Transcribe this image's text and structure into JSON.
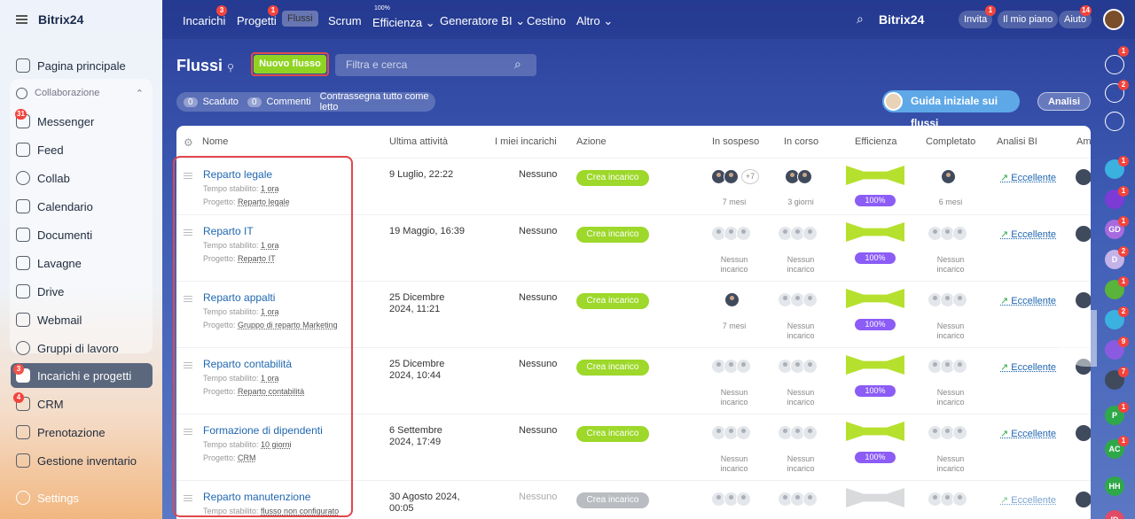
{
  "topbar": {
    "logo": "Bitrix24",
    "nav": [
      {
        "label": "Incarichi",
        "badge": "3"
      },
      {
        "label": "Progetti",
        "badge": "1"
      },
      {
        "label": "Flussi"
      },
      {
        "label": "Scrum"
      },
      {
        "label": "Efficienza",
        "sup": "100%"
      },
      {
        "label": "Generatore BI"
      },
      {
        "label": "Cestino"
      },
      {
        "label": "Altro"
      }
    ],
    "brand": "Bitrix24",
    "invite": "Invita",
    "invite_badge": "1",
    "plan": "Il mio piano",
    "help": "Aiuto",
    "help_badge": "14"
  },
  "sidebar": {
    "logo": "Bitrix24",
    "home": "Pagina principale",
    "group": "Collaborazione",
    "items": [
      {
        "label": "Messenger",
        "badge": "31"
      },
      {
        "label": "Feed"
      },
      {
        "label": "Collab"
      },
      {
        "label": "Calendario"
      },
      {
        "label": "Documenti"
      },
      {
        "label": "Lavagne"
      },
      {
        "label": "Drive"
      },
      {
        "label": "Webmail"
      },
      {
        "label": "Gruppi di lavoro"
      }
    ],
    "active": {
      "label": "Incarichi e progetti",
      "badge": "3"
    },
    "crm": {
      "label": "CRM",
      "badge": "4"
    },
    "more": [
      "Prenotazione",
      "Gestione inventario"
    ],
    "settings": "Settings"
  },
  "page": {
    "title": "Flussi",
    "new_button": "Nuovo flusso",
    "search_placeholder": "Filtra e cerca",
    "overdue_count": "0",
    "overdue_label": "Scaduto",
    "comments_count": "0",
    "comments_label": "Commenti",
    "mark_read": "Contrassegna tutto come letto",
    "guide": "Guida iniziale sui flussi",
    "analytics": "Analisi"
  },
  "columns": [
    "Nome",
    "Ultima attività",
    "I miei incarichi",
    "Azione",
    "In sospeso",
    "In corso",
    "Efficienza",
    "Completato",
    "Analisi BI",
    "Am"
  ],
  "rows": [
    {
      "name": "Reparto legale",
      "time_label": "Tempo stabilito:",
      "time": "1 ora",
      "proj_label": "Progetto:",
      "project": "Reparto legale",
      "last": "9 Luglio, 22:22",
      "last2": "",
      "mine": "Nessuno",
      "action": "Crea incarico",
      "pending": "7 mesi",
      "pending_more": "+7",
      "progress": "3 giorni",
      "eff": "100%",
      "done": "6 mesi",
      "bi": "Eccellente"
    },
    {
      "name": "Reparto IT",
      "time_label": "Tempo stabilito:",
      "time": "1 ora",
      "proj_label": "Progetto:",
      "project": "Reparto IT",
      "last": "19 Maggio, 16:39",
      "last2": "",
      "mine": "Nessuno",
      "action": "Crea incarico",
      "pending": "Nessun incarico",
      "progress": "Nessun incarico",
      "eff": "100%",
      "done": "Nessun incarico",
      "bi": "Eccellente"
    },
    {
      "name": "Reparto appalti",
      "time_label": "Tempo stabilito:",
      "time": "1 ora",
      "proj_label": "Progetto:",
      "project": "Gruppo di reparto Marketing",
      "last": "25 Dicembre",
      "last2": "2024, 11:21",
      "mine": "Nessuno",
      "action": "Crea incarico",
      "pending": "7 mesi",
      "progress": "Nessun incarico",
      "eff": "100%",
      "done": "Nessun incarico",
      "bi": "Eccellente"
    },
    {
      "name": "Reparto contabilità",
      "time_label": "Tempo stabilito:",
      "time": "1 ora",
      "proj_label": "Progetto:",
      "project": "Reparto contabilità",
      "last": "25 Dicembre",
      "last2": "2024, 10:44",
      "mine": "Nessuno",
      "action": "Crea incarico",
      "pending": "Nessun incarico",
      "progress": "Nessun incarico",
      "eff": "100%",
      "done": "Nessun incarico",
      "bi": "Eccellente"
    },
    {
      "name": "Formazione di dipendenti",
      "time_label": "Tempo stabilito:",
      "time": "10 giorni",
      "proj_label": "Progetto:",
      "project": "CRM",
      "last": "6 Settembre",
      "last2": "2024, 17:49",
      "mine": "Nessuno",
      "action": "Crea incarico",
      "pending": "Nessun incarico",
      "progress": "Nessun incarico",
      "eff": "100%",
      "done": "Nessun incarico",
      "bi": "Eccellente"
    },
    {
      "name": "Reparto manutenzione",
      "time_label": "Tempo stabilito:",
      "time": "flusso non configurato",
      "proj_label": "",
      "project": "",
      "last": "30 Agosto 2024,",
      "last2": "00:05",
      "mine": "Nessuno",
      "action": "Crea incarico",
      "pending": "",
      "progress": "",
      "eff": "",
      "done": "",
      "bi": "Eccellente"
    }
  ],
  "rail": {
    "badges": [
      "1",
      "2",
      "1",
      "1",
      "1",
      "2",
      "1",
      "2",
      "9",
      "7",
      "1",
      "1"
    ],
    "initials": [
      "GD",
      "D",
      "P",
      "AC",
      "HH",
      "ID"
    ]
  }
}
